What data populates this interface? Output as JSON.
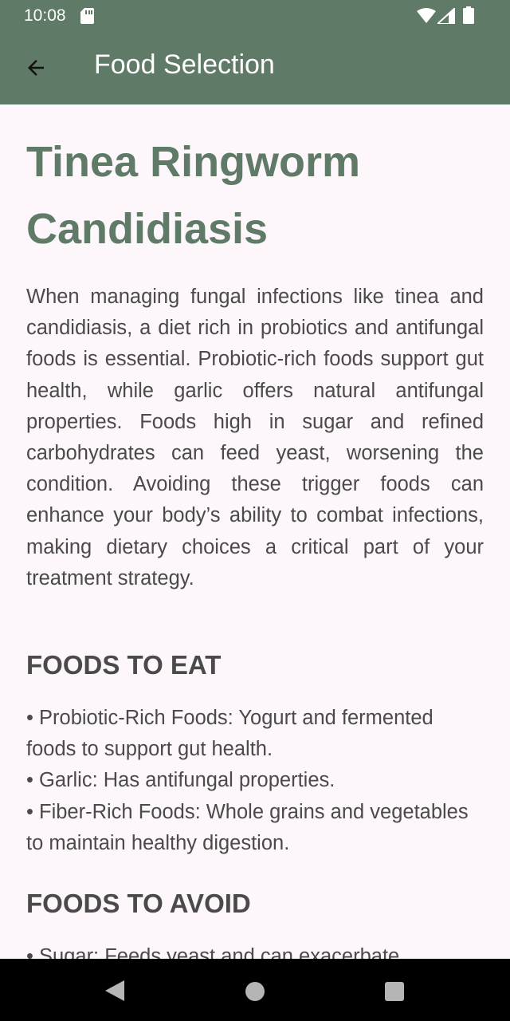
{
  "status_bar": {
    "time": "10:08",
    "icons": [
      "sd-card-icon",
      "wifi-icon",
      "signal-icon",
      "battery-icon"
    ]
  },
  "app_bar": {
    "title": "Food Selection",
    "back_icon": "arrow-back-icon"
  },
  "article": {
    "title": "Tinea Ringworm Candidiasis",
    "intro": "When managing fungal infections like tinea and candidiasis, a diet rich in probiotics and antifungal foods is essential. Probiotic-rich foods support gut health, while garlic offers natural antifungal properties. Foods high in sugar and refined carbohydrates can feed yeast, worsening the condition. Avoiding these trigger foods can enhance your body’s ability to combat infections, making dietary choices a critical part of your treatment strategy.",
    "eat_heading": "FOODS TO EAT",
    "eat_items": [
      "• Probiotic-Rich Foods: Yogurt and fermented foods to support gut health.",
      "• Garlic: Has antifungal properties.",
      "• Fiber-Rich Foods: Whole grains and vegetables to maintain healthy digestion."
    ],
    "avoid_heading": "FOODS TO AVOID",
    "avoid_items": [
      "• Sugar: Feeds yeast and can exacerbate"
    ]
  },
  "nav_bar": {
    "icons": [
      "nav-back-icon",
      "nav-home-icon",
      "nav-recents-icon"
    ]
  },
  "colors": {
    "primary": "#5f7a67",
    "background": "#fdf7fb",
    "text": "#4a4a4a"
  }
}
